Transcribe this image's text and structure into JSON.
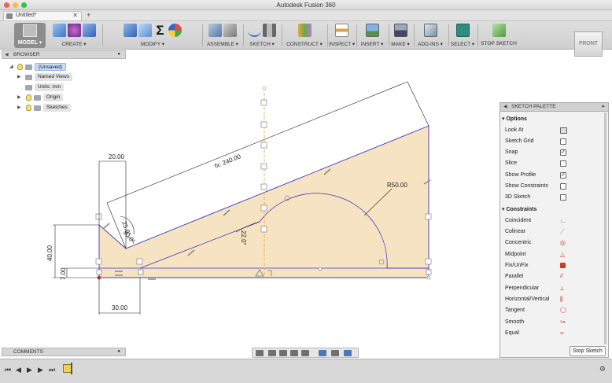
{
  "window": {
    "title": "Autodesk Fusion 360"
  },
  "tab": {
    "label": "Untitled*",
    "close": "✕",
    "add": "+"
  },
  "toolbar": {
    "workspace": "MODEL ▾",
    "groups": [
      {
        "label": "CREATE ▾"
      },
      {
        "label": "MODIFY ▾"
      },
      {
        "label": "ASSEMBLE ▾"
      },
      {
        "label": "SKETCH ▾"
      },
      {
        "label": "CONSTRUCT ▾"
      },
      {
        "label": "INSPECT ▾"
      },
      {
        "label": "INSERT ▾"
      },
      {
        "label": "MAKE ▾"
      },
      {
        "label": "ADD-INS ▾"
      },
      {
        "label": "SELECT ▾"
      },
      {
        "label": "STOP SKETCH"
      }
    ]
  },
  "viewcube": {
    "label": "FRONT"
  },
  "browser": {
    "title": "BROWSER",
    "items": [
      {
        "label": "(Unsaved)"
      },
      {
        "label": "Named Views"
      },
      {
        "label": "Units: mm"
      },
      {
        "label": "Origin"
      },
      {
        "label": "Sketches"
      }
    ]
  },
  "sketch": {
    "dimensions": {
      "top_width": "20.00",
      "diagonal": "fx: 240.00",
      "radius": "R50.00",
      "angle_a": "25.0°",
      "angle_b": "90.0°",
      "angle_c": "22.0°",
      "height": "40.00",
      "base_height": "7.00",
      "bottom_width": "30.00"
    },
    "colors": {
      "fill": "#f6e3c1",
      "line": "#3b35c7",
      "axis": "#f0a040"
    }
  },
  "palette": {
    "title": "SKETCH PALETTE",
    "options_title": "Options",
    "options": [
      {
        "label": "Look At",
        "checked": ""
      },
      {
        "label": "Sketch Grid",
        "checked": ""
      },
      {
        "label": "Snap",
        "checked": "✓"
      },
      {
        "label": "Slice",
        "checked": ""
      },
      {
        "label": "Show Profile",
        "checked": "✓"
      },
      {
        "label": "Show Constraints",
        "checked": ""
      },
      {
        "label": "3D Sketch",
        "checked": ""
      }
    ],
    "constraints_title": "Constraints",
    "constraints": [
      {
        "label": "Coincident",
        "glyph": "∟"
      },
      {
        "label": "Colinear",
        "glyph": "⟋"
      },
      {
        "label": "Concentric",
        "glyph": "◎"
      },
      {
        "label": "Midpoint",
        "glyph": "△"
      },
      {
        "label": "Fix/UnFix",
        "glyph": "🔒"
      },
      {
        "label": "Parallel",
        "glyph": "//"
      },
      {
        "label": "Perpendicular",
        "glyph": "⟂"
      },
      {
        "label": "Horizontal/Vertical",
        "glyph": "⫼"
      },
      {
        "label": "Tangent",
        "glyph": "◯"
      },
      {
        "label": "Smooth",
        "glyph": "↪"
      },
      {
        "label": "Equal",
        "glyph": "="
      }
    ],
    "stop_button": "Stop Sketch"
  },
  "comments": {
    "label": "COMMENTS"
  }
}
